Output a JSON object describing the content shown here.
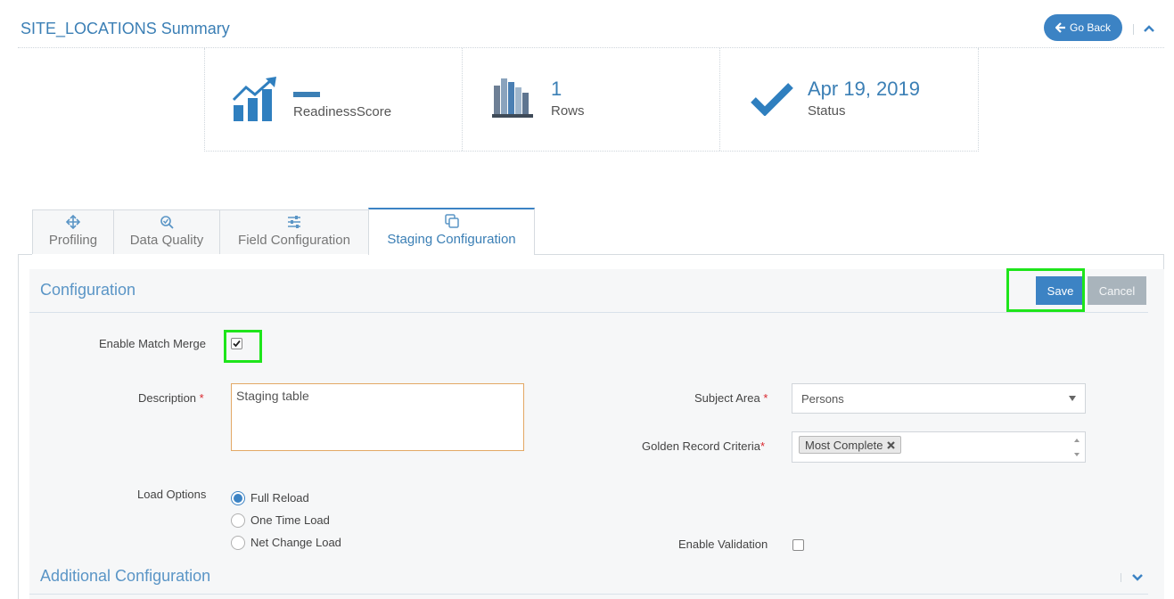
{
  "header": {
    "title": "SITE_LOCATIONS Summary",
    "go_back_label": "Go Back",
    "icons": [
      "arrow-left-icon",
      "chevron-up-icon"
    ]
  },
  "stats": [
    {
      "icon": "trend-chart-icon",
      "value": "",
      "label": "ReadinessScore"
    },
    {
      "icon": "bar-columns-icon",
      "value": "1",
      "label": "Rows"
    },
    {
      "icon": "checkmark-icon",
      "value": "Apr 19, 2019",
      "label": "Status"
    }
  ],
  "tabs": [
    {
      "label": "Profiling",
      "icon": "move-arrows-icon",
      "active": false
    },
    {
      "label": "Data Quality",
      "icon": "magnifier-check-icon",
      "active": false
    },
    {
      "label": "Field Configuration",
      "icon": "sliders-icon",
      "active": false
    },
    {
      "label": "Staging Configuration",
      "icon": "copy-icon",
      "active": true
    }
  ],
  "configuration": {
    "title": "Configuration",
    "save_label": "Save",
    "cancel_label": "Cancel",
    "enable_match_merge": {
      "label": "Enable Match Merge",
      "checked": true
    },
    "description": {
      "label": "Description",
      "required_mark": "*",
      "value": "Staging table"
    },
    "subject_area": {
      "label": "Subject Area",
      "required_mark": "*",
      "value": "Persons"
    },
    "golden_record": {
      "label": "Golden Record Criteria",
      "required_mark": "*",
      "tags": [
        "Most Complete"
      ]
    },
    "load_options": {
      "label": "Load Options",
      "options": [
        "Full Reload",
        "One Time Load",
        "Net Change Load"
      ],
      "selected": "Full Reload"
    },
    "enable_validation": {
      "label": "Enable Validation",
      "checked": false
    }
  },
  "additional": {
    "title": "Additional Configuration"
  },
  "colors": {
    "accent": "#3c83c4",
    "title_blue": "#3b7fb5",
    "highlight": "#1ee51b",
    "required": "#d9272e"
  }
}
